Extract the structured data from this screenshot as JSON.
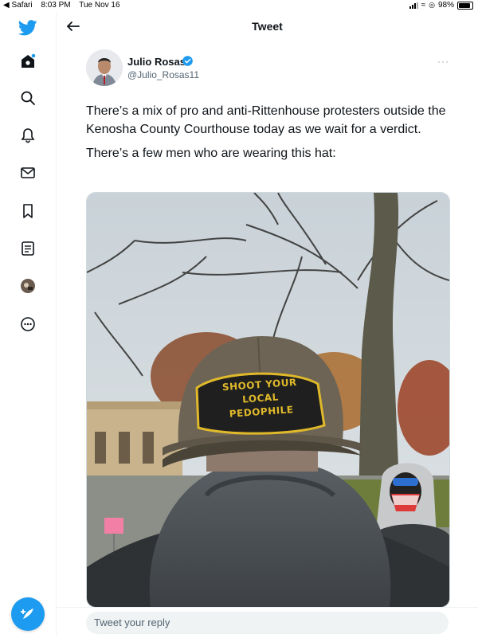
{
  "status_bar": {
    "back_app": "◀ Safari",
    "time": "8:03 PM",
    "date": "Tue Nov 16",
    "battery": "98%"
  },
  "header": {
    "title": "Tweet"
  },
  "tweet": {
    "author_name": "Julio Rosas",
    "author_handle": "@Julio_Rosas11",
    "paragraphs": [
      "There’s a mix of pro and anti-Rittenhouse protesters outside the Kenosha County Courthouse today as we wait for a verdict.",
      "There’s a few men who are wearing this hat:"
    ],
    "photo": {
      "hat_patch_text": [
        "SHOOT YOUR",
        "LOCAL",
        "PEDOPHILE"
      ]
    }
  },
  "reply": {
    "placeholder": "Tweet your reply"
  },
  "icons": [
    "twitter-logo-icon",
    "home-icon",
    "search-icon",
    "bell-icon",
    "mail-icon",
    "bookmark-icon",
    "list-icon",
    "profile-avatar-icon",
    "more-circle-icon",
    "compose-icon",
    "back-arrow-icon",
    "verified-icon",
    "more-dots-icon"
  ],
  "colors": {
    "accent": "#1d9bf0",
    "text": "#0f1419",
    "muted": "#536471",
    "patch_yellow": "#e0b92b"
  }
}
